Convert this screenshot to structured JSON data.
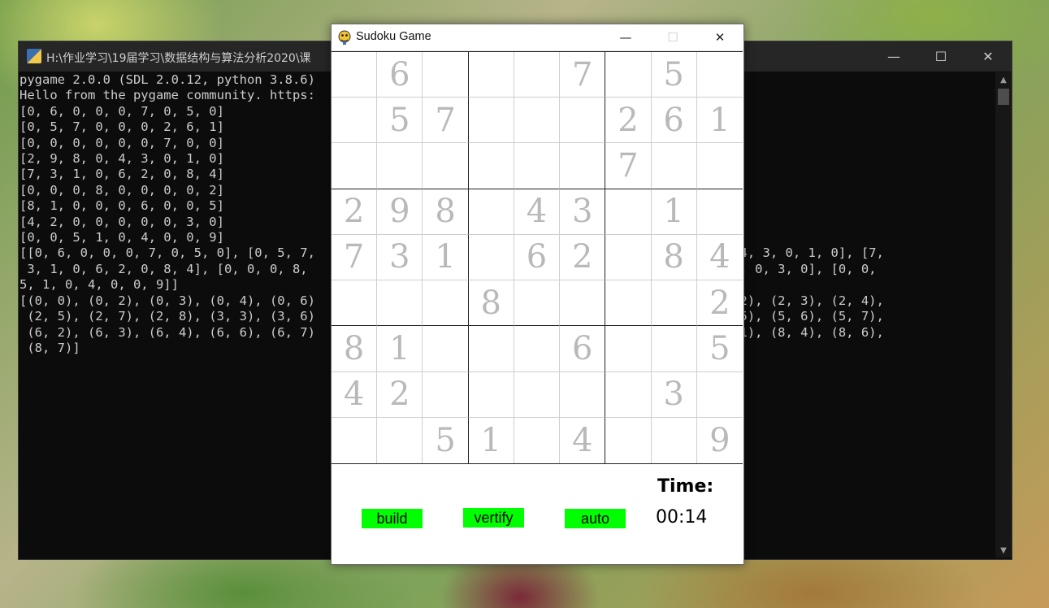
{
  "console": {
    "title": "H:\\作业学习\\19届学习\\数据结构与算法分析2020\\课",
    "lines": [
      "pygame 2.0.0 (SDL 2.0.12, python 3.8.6)",
      "Hello from the pygame community. https:",
      "[0, 6, 0, 0, 0, 7, 0, 5, 0]",
      "[0, 5, 7, 0, 0, 0, 2, 6, 1]",
      "[0, 0, 0, 0, 0, 0, 7, 0, 0]",
      "[2, 9, 8, 0, 4, 3, 0, 1, 0]",
      "[7, 3, 1, 0, 6, 2, 0, 8, 4]",
      "[0, 0, 0, 8, 0, 0, 0, 0, 2]",
      "[8, 1, 0, 0, 0, 6, 0, 0, 5]",
      "[4, 2, 0, 0, 0, 0, 0, 3, 0]",
      "[0, 0, 5, 1, 0, 4, 0, 0, 9]",
      "[[0, 6, 0, 0, 0, 7, 0, 5, 0], [0, 5, 7,                                            2, 9, 8, 0, 4, 3, 0, 1, 0], [7,",
      " 3, 1, 0, 6, 2, 0, 8, 4], [0, 0, 0, 8,                                             , 0, 0, 0, 0, 0, 3, 0], [0, 0,",
      "5, 1, 0, 4, 0, 0, 9]]",
      "[(0, 0), (0, 2), (0, 3), (0, 4), (0, 6)                                            (2, 1), (2, 2), (2, 3), (2, 4),",
      " (2, 5), (2, 7), (2, 8), (3, 3), (3, 6)                                            (5, 4), (5, 5), (5, 6), (5, 7),",
      " (6, 2), (6, 3), (6, 4), (6, 6), (6, 7)                                            (8, 0), (8, 1), (8, 4), (8, 6),",
      " (8, 7)]"
    ]
  },
  "game": {
    "title": "Sudoku Game",
    "board": [
      [
        0,
        6,
        0,
        0,
        0,
        7,
        0,
        5,
        0
      ],
      [
        0,
        5,
        7,
        0,
        0,
        0,
        2,
        6,
        1
      ],
      [
        0,
        0,
        0,
        0,
        0,
        0,
        7,
        0,
        0
      ],
      [
        2,
        9,
        8,
        0,
        4,
        3,
        0,
        1,
        0
      ],
      [
        7,
        3,
        1,
        0,
        6,
        2,
        0,
        8,
        4
      ],
      [
        0,
        0,
        0,
        8,
        0,
        0,
        0,
        0,
        2
      ],
      [
        8,
        1,
        0,
        0,
        0,
        6,
        0,
        0,
        5
      ],
      [
        4,
        2,
        0,
        0,
        0,
        0,
        0,
        3,
        0
      ],
      [
        0,
        0,
        5,
        1,
        0,
        4,
        0,
        0,
        9
      ]
    ],
    "buttons": {
      "build": "build",
      "vertify": "vertify",
      "auto": "auto"
    },
    "time_label": "Time:",
    "time_value": "00:14"
  },
  "colors": {
    "button_green": "#00ff00",
    "given_digit": "#b9b9b9",
    "console_bg": "#0c0c0c",
    "console_text": "#cccccc"
  },
  "icons": {
    "console": "python-console-icon",
    "game": "pygame-snake-icon"
  }
}
